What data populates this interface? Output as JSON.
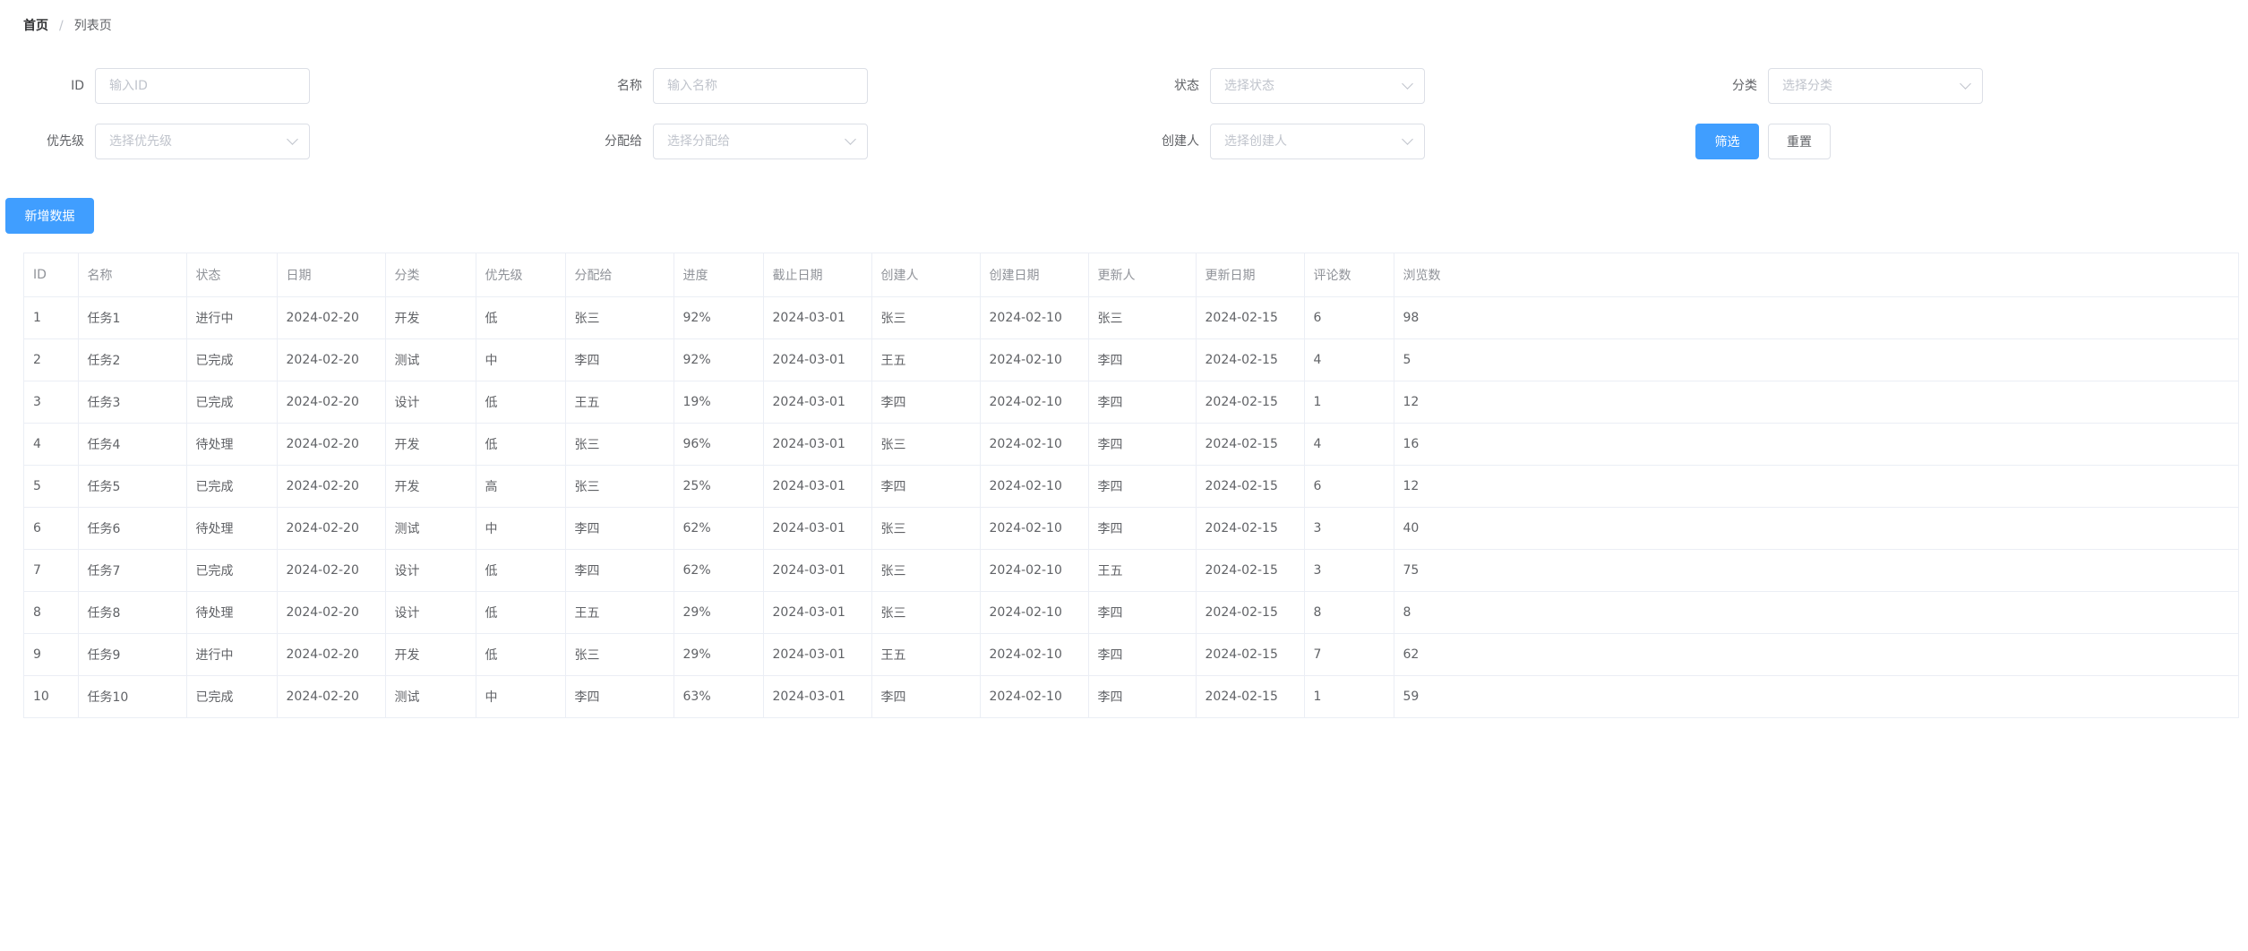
{
  "breadcrumb": {
    "home": "首页",
    "separator": "/",
    "current": "列表页"
  },
  "filters": {
    "id": {
      "label": "ID",
      "placeholder": "输入ID"
    },
    "name": {
      "label": "名称",
      "placeholder": "输入名称"
    },
    "status": {
      "label": "状态",
      "placeholder": "选择状态"
    },
    "category": {
      "label": "分类",
      "placeholder": "选择分类"
    },
    "priority": {
      "label": "优先级",
      "placeholder": "选择优先级"
    },
    "assignee": {
      "label": "分配给",
      "placeholder": "选择分配给"
    },
    "creator": {
      "label": "创建人",
      "placeholder": "选择创建人"
    }
  },
  "buttons": {
    "filter": "筛选",
    "reset": "重置",
    "add": "新增数据"
  },
  "colors": {
    "primary": "#409eff",
    "border": "#dcdfe6",
    "table_border": "#ebeef5"
  },
  "table": {
    "columns": [
      "ID",
      "名称",
      "状态",
      "日期",
      "分类",
      "优先级",
      "分配给",
      "进度",
      "截止日期",
      "创建人",
      "创建日期",
      "更新人",
      "更新日期",
      "评论数",
      "浏览数"
    ],
    "rows": [
      [
        "1",
        "任务1",
        "进行中",
        "2024-02-20",
        "开发",
        "低",
        "张三",
        "92%",
        "2024-03-01",
        "张三",
        "2024-02-10",
        "张三",
        "2024-02-15",
        "6",
        "98"
      ],
      [
        "2",
        "任务2",
        "已完成",
        "2024-02-20",
        "测试",
        "中",
        "李四",
        "92%",
        "2024-03-01",
        "王五",
        "2024-02-10",
        "李四",
        "2024-02-15",
        "4",
        "5"
      ],
      [
        "3",
        "任务3",
        "已完成",
        "2024-02-20",
        "设计",
        "低",
        "王五",
        "19%",
        "2024-03-01",
        "李四",
        "2024-02-10",
        "李四",
        "2024-02-15",
        "1",
        "12"
      ],
      [
        "4",
        "任务4",
        "待处理",
        "2024-02-20",
        "开发",
        "低",
        "张三",
        "96%",
        "2024-03-01",
        "张三",
        "2024-02-10",
        "李四",
        "2024-02-15",
        "4",
        "16"
      ],
      [
        "5",
        "任务5",
        "已完成",
        "2024-02-20",
        "开发",
        "高",
        "张三",
        "25%",
        "2024-03-01",
        "李四",
        "2024-02-10",
        "李四",
        "2024-02-15",
        "6",
        "12"
      ],
      [
        "6",
        "任务6",
        "待处理",
        "2024-02-20",
        "测试",
        "中",
        "李四",
        "62%",
        "2024-03-01",
        "张三",
        "2024-02-10",
        "李四",
        "2024-02-15",
        "3",
        "40"
      ],
      [
        "7",
        "任务7",
        "已完成",
        "2024-02-20",
        "设计",
        "低",
        "李四",
        "62%",
        "2024-03-01",
        "张三",
        "2024-02-10",
        "王五",
        "2024-02-15",
        "3",
        "75"
      ],
      [
        "8",
        "任务8",
        "待处理",
        "2024-02-20",
        "设计",
        "低",
        "王五",
        "29%",
        "2024-03-01",
        "张三",
        "2024-02-10",
        "李四",
        "2024-02-15",
        "8",
        "8"
      ],
      [
        "9",
        "任务9",
        "进行中",
        "2024-02-20",
        "开发",
        "低",
        "张三",
        "29%",
        "2024-03-01",
        "王五",
        "2024-02-10",
        "李四",
        "2024-02-15",
        "7",
        "62"
      ],
      [
        "10",
        "任务10",
        "已完成",
        "2024-02-20",
        "测试",
        "中",
        "李四",
        "63%",
        "2024-03-01",
        "李四",
        "2024-02-10",
        "李四",
        "2024-02-15",
        "1",
        "59"
      ]
    ]
  }
}
